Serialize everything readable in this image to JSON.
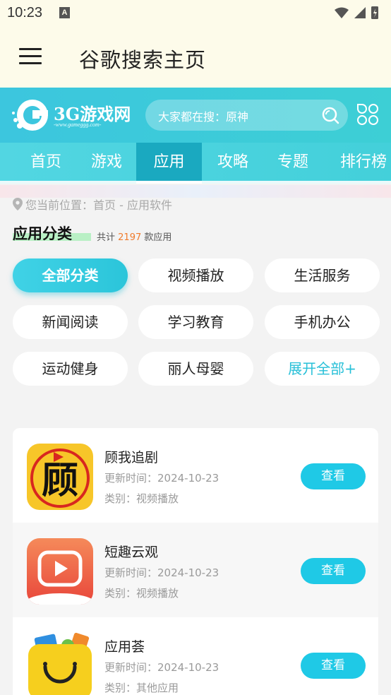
{
  "status_bar": {
    "time": "10:23",
    "notification_letter": "A"
  },
  "app_bar": {
    "title": "谷歌搜索主页"
  },
  "site": {
    "logo_text": "3G游戏网",
    "logo_subtext": "-www.gameggg.com-",
    "search_placeholder": "大家都在搜：原神",
    "accent_color": "#3cc6de"
  },
  "nav": {
    "items": [
      {
        "label": "首页"
      },
      {
        "label": "游戏"
      },
      {
        "label": "应用"
      },
      {
        "label": "攻略"
      },
      {
        "label": "专题"
      },
      {
        "label": "排行榜"
      }
    ],
    "active_index": 2
  },
  "breadcrumb": {
    "text": "您当前位置：首页 - 应用软件"
  },
  "section": {
    "title": "应用分类",
    "count_prefix": "共计",
    "count_value": "2197",
    "count_suffix": "款应用"
  },
  "categories": [
    {
      "label": "全部分类",
      "active": true
    },
    {
      "label": "视频播放"
    },
    {
      "label": "生活服务"
    },
    {
      "label": "新闻阅读"
    },
    {
      "label": "学习教育"
    },
    {
      "label": "手机办公"
    },
    {
      "label": "运动健身"
    },
    {
      "label": "丽人母婴"
    },
    {
      "label": "展开全部+"
    }
  ],
  "apps": [
    {
      "name": "顾我追剧",
      "updated": "更新时间：2024-10-23",
      "category": "类别：视频播放",
      "button": "查看",
      "icon": "guwo-icon",
      "icon_glyph": "顾"
    },
    {
      "name": "短趣云观",
      "updated": "更新时间：2024-10-23",
      "category": "类别：视频播放",
      "button": "查看",
      "icon": "play-video-icon"
    },
    {
      "name": "应用荟",
      "updated": "更新时间：2024-10-23",
      "category": "类别：其他应用",
      "button": "查看",
      "icon": "smile-bag-icon"
    }
  ]
}
